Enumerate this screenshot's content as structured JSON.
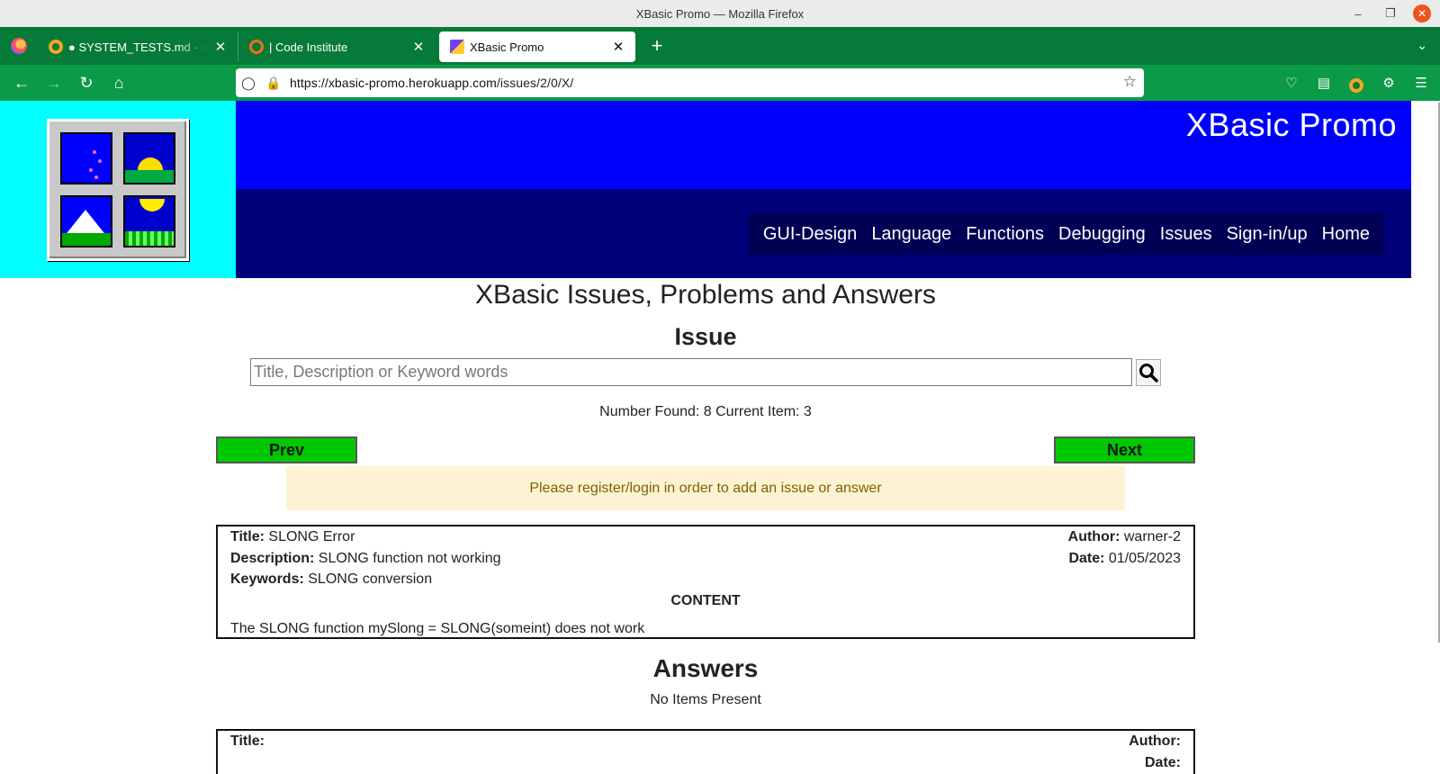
{
  "window": {
    "title": "XBasic Promo — Mozilla Firefox"
  },
  "tabs": [
    {
      "label": "● SYSTEM_TESTS.md - xbasic-promo",
      "icon": "gitpod-icon"
    },
    {
      "label": "| Code Institute",
      "icon": "code-institute-icon"
    },
    {
      "label": "XBasic Promo",
      "icon": "xbasic-icon"
    }
  ],
  "urlbar": {
    "host": "https://xbasic-promo.herokuapp.com",
    "path": "/issues/2/0/X/"
  },
  "site": {
    "title": "XBasic Promo",
    "nav": [
      "GUI-Design",
      "Language",
      "Functions",
      "Debugging",
      "Issues",
      "Sign-in/up",
      "Home"
    ]
  },
  "page": {
    "heading": "XBasic Issues, Problems and Answers",
    "subheading": "Issue",
    "search_placeholder": "Title, Description or Keyword words",
    "found_text": "Number Found: 8 Current Item: 3",
    "prev_label": "Prev",
    "next_label": "Next",
    "notice": "Please register/login in order to add an issue or answer"
  },
  "issue": {
    "title_label": "Title:",
    "title": "SLONG Error",
    "description_label": "Description:",
    "description": "SLONG function not working",
    "keywords_label": "Keywords:",
    "keywords": "SLONG conversion",
    "author_label": "Author:",
    "author": "warner-2",
    "date_label": "Date:",
    "date": "01/05/2023",
    "content_label": "CONTENT",
    "content": "The SLONG function mySlong = SLONG(someint) does not work"
  },
  "answers": {
    "heading": "Answers",
    "empty_text": "No Items Present",
    "title_label": "Title:",
    "author_label": "Author:",
    "date_label": "Date:"
  }
}
